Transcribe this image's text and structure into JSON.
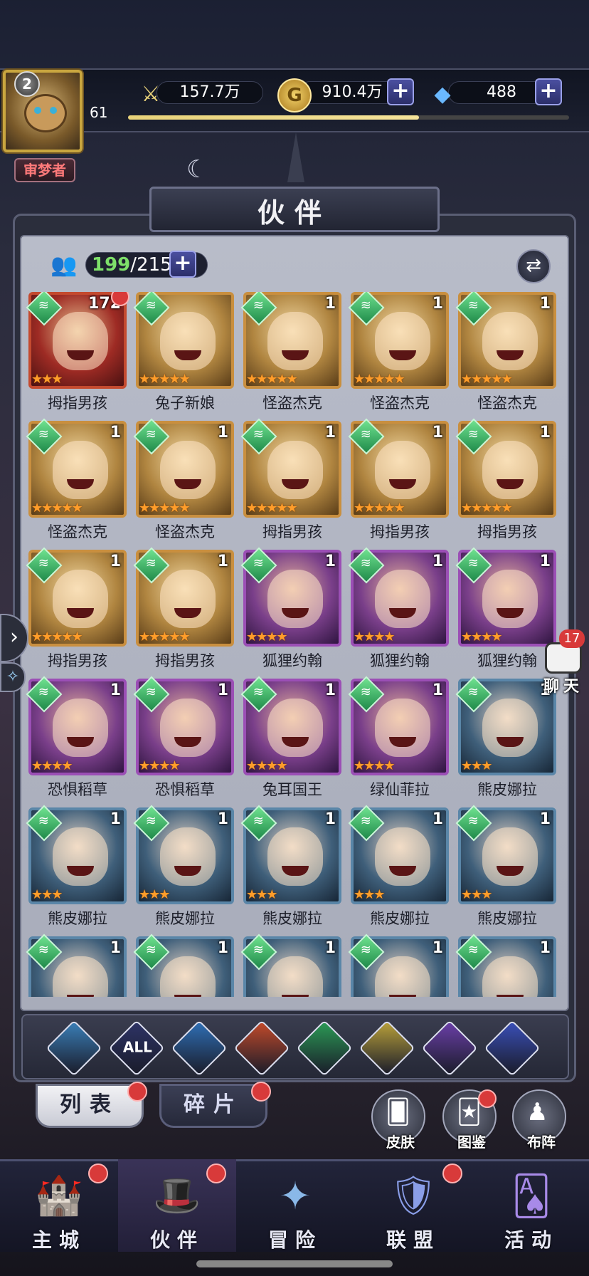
{
  "player": {
    "level": "2",
    "exp_level": "61",
    "exp_progress": 0.66,
    "title": "审梦者"
  },
  "resources": {
    "power": "157.7万",
    "gold": "910.4万",
    "diamond": "488"
  },
  "icons": {
    "power": "sword-icon",
    "gold": "gold-coin-icon",
    "diamond": "diamond-icon",
    "swap": "swap-arrows-icon",
    "add": "plus-icon",
    "chat": "chat-bubble-icon"
  },
  "panel": {
    "title": "伙伴",
    "count_current": "199",
    "count_total": "/215"
  },
  "heroes": [
    {
      "name": "拇指男孩",
      "copies": "172",
      "stars": 3,
      "frame": "red",
      "notify": true
    },
    {
      "name": "兔子新娘",
      "copies": "",
      "stars": 5,
      "frame": "gold",
      "notify": false
    },
    {
      "name": "怪盗杰克",
      "copies": "1",
      "stars": 5,
      "frame": "gold",
      "notify": false
    },
    {
      "name": "怪盗杰克",
      "copies": "1",
      "stars": 5,
      "frame": "gold",
      "notify": false
    },
    {
      "name": "怪盗杰克",
      "copies": "1",
      "stars": 5,
      "frame": "gold",
      "notify": false
    },
    {
      "name": "怪盗杰克",
      "copies": "1",
      "stars": 5,
      "frame": "gold",
      "notify": false
    },
    {
      "name": "怪盗杰克",
      "copies": "1",
      "stars": 5,
      "frame": "gold",
      "notify": false
    },
    {
      "name": "拇指男孩",
      "copies": "1",
      "stars": 5,
      "frame": "gold",
      "notify": false
    },
    {
      "name": "拇指男孩",
      "copies": "1",
      "stars": 5,
      "frame": "gold",
      "notify": false
    },
    {
      "name": "拇指男孩",
      "copies": "1",
      "stars": 5,
      "frame": "gold",
      "notify": false
    },
    {
      "name": "拇指男孩",
      "copies": "1",
      "stars": 5,
      "frame": "gold",
      "notify": false
    },
    {
      "name": "拇指男孩",
      "copies": "1",
      "stars": 5,
      "frame": "gold",
      "notify": false
    },
    {
      "name": "狐狸约翰",
      "copies": "1",
      "stars": 4,
      "frame": "purple",
      "notify": false
    },
    {
      "name": "狐狸约翰",
      "copies": "1",
      "stars": 4,
      "frame": "purple",
      "notify": false
    },
    {
      "name": "狐狸约翰",
      "copies": "1",
      "stars": 4,
      "frame": "purple",
      "notify": false
    },
    {
      "name": "恐惧稻草",
      "copies": "1",
      "stars": 4,
      "frame": "purple",
      "notify": false
    },
    {
      "name": "恐惧稻草",
      "copies": "1",
      "stars": 4,
      "frame": "purple",
      "notify": false
    },
    {
      "name": "兔耳国王",
      "copies": "1",
      "stars": 4,
      "frame": "purple",
      "notify": false
    },
    {
      "name": "绿仙菲拉",
      "copies": "1",
      "stars": 4,
      "frame": "purple",
      "notify": false
    },
    {
      "name": "熊皮娜拉",
      "copies": "1",
      "stars": 3,
      "frame": "blue",
      "notify": false
    },
    {
      "name": "熊皮娜拉",
      "copies": "1",
      "stars": 3,
      "frame": "blue",
      "notify": false
    },
    {
      "name": "熊皮娜拉",
      "copies": "1",
      "stars": 3,
      "frame": "blue",
      "notify": false
    },
    {
      "name": "熊皮娜拉",
      "copies": "1",
      "stars": 3,
      "frame": "blue",
      "notify": false
    },
    {
      "name": "熊皮娜拉",
      "copies": "1",
      "stars": 3,
      "frame": "blue",
      "notify": false
    },
    {
      "name": "熊皮娜拉",
      "copies": "1",
      "stars": 3,
      "frame": "blue",
      "notify": false
    },
    {
      "name": "",
      "copies": "1",
      "stars": 0,
      "frame": "blue",
      "notify": false
    },
    {
      "name": "",
      "copies": "1",
      "stars": 0,
      "frame": "blue",
      "notify": false
    },
    {
      "name": "",
      "copies": "1",
      "stars": 0,
      "frame": "blue",
      "notify": false
    },
    {
      "name": "",
      "copies": "1",
      "stars": 0,
      "frame": "blue",
      "notify": false
    },
    {
      "name": "",
      "copies": "1",
      "stars": 0,
      "frame": "blue",
      "notify": false
    }
  ],
  "filters": [
    {
      "label": "",
      "icon": "all-factions-icon",
      "color": "#3a7fb8"
    },
    {
      "label": "ALL",
      "icon": "all-icon",
      "color": "#2d3366"
    },
    {
      "label": "",
      "icon": "water-drop-icon",
      "color": "#2f6fb5"
    },
    {
      "label": "",
      "icon": "fire-icon",
      "color": "#c24a2a"
    },
    {
      "label": "",
      "icon": "wind-icon",
      "color": "#2b9a55"
    },
    {
      "label": "",
      "icon": "light-star-icon",
      "color": "#b8a03a"
    },
    {
      "label": "",
      "icon": "moon-icon",
      "color": "#6b3fa8"
    },
    {
      "label": "",
      "icon": "planet-icon",
      "color": "#3a4fb8"
    }
  ],
  "tabs": {
    "list": "列表",
    "fragments": "碎片"
  },
  "side_buttons": {
    "skin": "皮肤",
    "codex": "图鉴",
    "formation": "布阵"
  },
  "chat": {
    "label": "聊天",
    "unread": "17"
  },
  "nav": {
    "home": "主城",
    "partners": "伙伴",
    "adventure": "冒险",
    "guild": "联盟",
    "events": "活动"
  }
}
